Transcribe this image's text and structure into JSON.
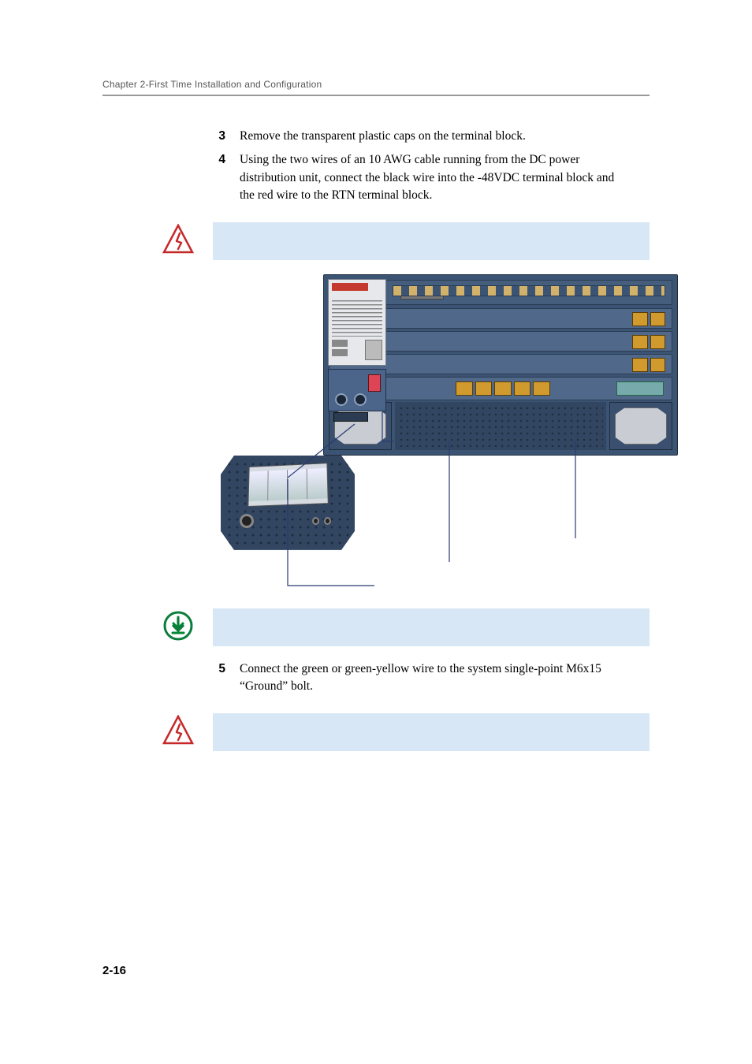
{
  "header": {
    "running_head": "Chapter 2-First Time Installation and Configuration"
  },
  "steps": {
    "s3": {
      "num": "3",
      "text": "Remove the transparent plastic caps on the terminal block."
    },
    "s4": {
      "num": "4",
      "text": "Using the two wires of an 10 AWG cable running from the DC power distribution unit, connect the black wire into the -48VDC terminal block and the red wire to the RTN terminal block."
    },
    "s5": {
      "num": "5",
      "text": "Connect the green or green-yellow wire to the system single-point M6x15 “Ground” bolt."
    }
  },
  "callouts": {
    "warning1": "",
    "tip": "",
    "warning2": ""
  },
  "footer": {
    "page_number": "2-16"
  }
}
